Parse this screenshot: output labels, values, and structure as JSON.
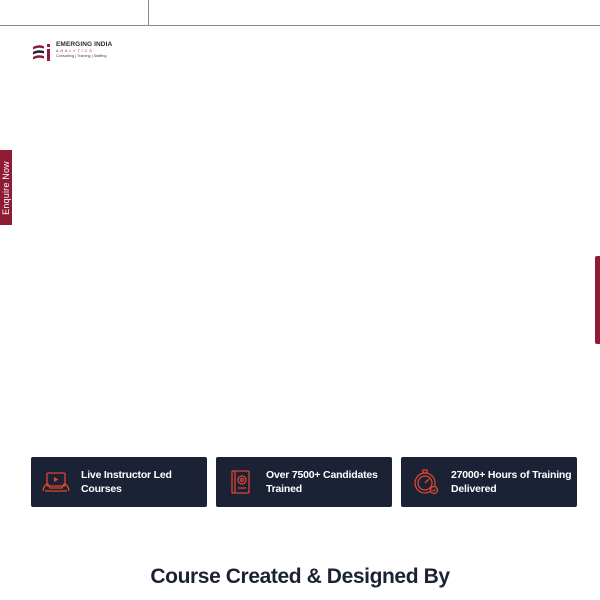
{
  "brand": {
    "name_part1": "EMERGING INDIA",
    "sub": "ANALYTICS",
    "tagline": "Consulting | Training | Staffing",
    "accent_color": "#8e1c34",
    "dark_color": "#1b2235"
  },
  "side_tabs": {
    "enquire_label": "Enquire Now",
    "right_label": ""
  },
  "features": [
    {
      "icon": "instructor-screen-icon",
      "text": "Live Instructor Led Courses"
    },
    {
      "icon": "certificate-book-icon",
      "text": "Over 7500+ Candidates Trained"
    },
    {
      "icon": "stopwatch-icon",
      "text": "27000+ Hours of Training Delivered"
    }
  ],
  "section": {
    "heading": "Course Created & Designed By"
  }
}
